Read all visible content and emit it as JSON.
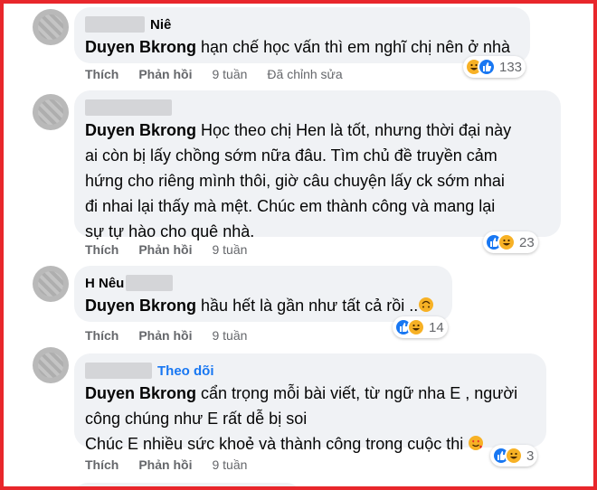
{
  "comments": [
    {
      "author_visible": "Niê",
      "tag": "Duyen Bkrong",
      "text": "hạn chế học vấn thì em nghĩ chị nên ở nhà",
      "actions": {
        "like": "Thích",
        "reply": "Phản hồi",
        "time": "9 tuần",
        "edited": "Đã chỉnh sửa"
      },
      "reaction_count": "133",
      "reactions": [
        "haha-icon",
        "like-icon"
      ]
    },
    {
      "author_visible": "",
      "tag": "Duyen Bkrong",
      "lines": [
        "Học theo chị Hen là tốt, nhưng thời đại này",
        "ai còn bị lấy chồng sớm nữa đâu. Tìm chủ đề truyền cảm",
        "hứng cho riêng mình thôi, giờ câu chuyện lấy ck sớm nhai",
        "đi nhai lại thấy mà mệt. Chúc em thành công và mang lại",
        "sự tự hào cho quê nhà."
      ],
      "actions": {
        "like": "Thích",
        "reply": "Phản hồi",
        "time": "9 tuần"
      },
      "reaction_count": "23",
      "reactions": [
        "like-icon",
        "haha-icon"
      ]
    },
    {
      "author_visible": "H Nêu",
      "tag": "Duyen Bkrong",
      "text": "hầu hết là gần như tất cả rồi ..",
      "actions": {
        "like": "Thích",
        "reply": "Phản hồi",
        "time": "9 tuần"
      },
      "reaction_count": "14",
      "reactions": [
        "like-icon",
        "haha-icon"
      ]
    },
    {
      "author_visible": "",
      "follow": "Theo dõi",
      "tag": "Duyen Bkrong",
      "lines": [
        "cẩn trọng mỗi bài viết, từ ngữ nha E , người",
        "công chúng như E rất dễ bị soi",
        "Chúc E nhiều sức khoẻ và thành công trong cuộc thi"
      ],
      "actions": {
        "like": "Thích",
        "reply": "Phản hồi",
        "time": "9 tuần"
      },
      "reaction_count": "3",
      "reactions": [
        "like-icon",
        "haha-icon"
      ]
    }
  ],
  "colors": {
    "border": "#e8262b",
    "bubble": "#f0f2f5",
    "link": "#1877f2",
    "muted": "#65676b"
  }
}
